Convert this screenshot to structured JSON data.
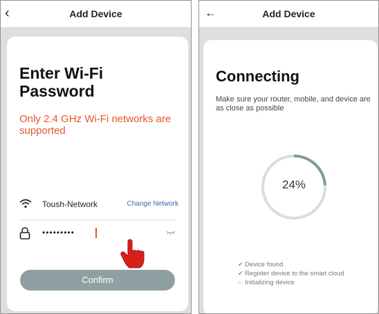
{
  "screen1": {
    "header": {
      "title": "Add Device",
      "back_icon": "chevron-left-icon"
    },
    "heading": "Enter Wi-Fi Password",
    "warning": "Only 2.4 GHz Wi-Fi networks are supported",
    "network": {
      "icon": "wifi-icon",
      "name": "Toush-Network",
      "change_label": "Change Network"
    },
    "password": {
      "icon": "lock-icon",
      "value": "•••••••••",
      "visibility_icon": "eye-closed-icon"
    },
    "confirm_label": "Confirm",
    "pointer_icon": "hand-pointer-icon"
  },
  "screen2": {
    "header": {
      "title": "Add Device",
      "back_icon": "arrow-left-icon"
    },
    "heading": "Connecting",
    "subtitle": "Make sure your router, mobile, and device are as close as possible",
    "progress": {
      "value": 24,
      "label": "24%"
    },
    "steps": [
      {
        "label": "Device found",
        "status": "done"
      },
      {
        "label": "Register device to the smart cloud",
        "status": "done"
      },
      {
        "label": "Initializing device",
        "status": "pending"
      }
    ]
  },
  "colors": {
    "accent_warning": "#e8542a",
    "link": "#2f6fb0",
    "button": "#8fa0a3",
    "progress": "#7a9c9a",
    "check": "#6aa84f"
  }
}
